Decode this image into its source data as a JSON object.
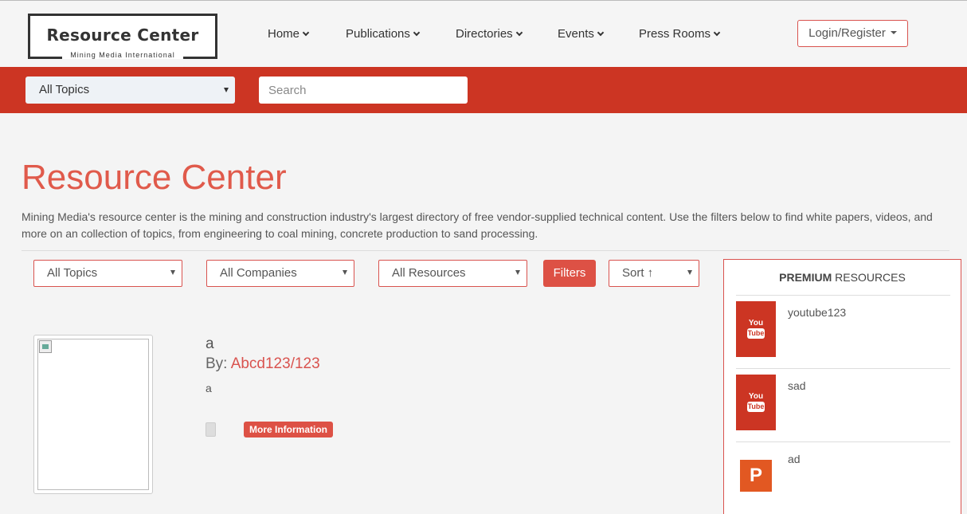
{
  "header": {
    "logo_title": "Resource Center",
    "logo_subtitle": "Mining Media International",
    "nav": [
      {
        "label": "Home"
      },
      {
        "label": "Publications"
      },
      {
        "label": "Directories"
      },
      {
        "label": "Events"
      },
      {
        "label": "Press Rooms"
      }
    ],
    "login_label": "Login/Register"
  },
  "searchbar": {
    "topic_selected": "All Topics",
    "search_placeholder": "Search"
  },
  "intro": {
    "title": "Resource Center",
    "description": "Mining Media's resource center is the mining and construction industry's largest directory of free vendor-supplied technical content. Use the filters below to find white papers, videos, and more on an collection of topics, from engineering to coal mining, concrete production to sand processing."
  },
  "filters": {
    "topics": "All Topics",
    "companies": "All Companies",
    "resources": "All Resources",
    "filters_button": "Filters",
    "sort": "Sort ↑"
  },
  "results": [
    {
      "title": "a",
      "by_label": "By:",
      "author": "Abcd123/123",
      "description": "a",
      "more_label": "More Information"
    }
  ],
  "premium": {
    "heading_bold": "PREMIUM",
    "heading_rest": "RESOURCES",
    "items": [
      {
        "name": "youtube123",
        "icon": "youtube-icon"
      },
      {
        "name": "sad",
        "icon": "youtube-icon"
      },
      {
        "name": "ad",
        "icon": "powerpoint-icon"
      }
    ]
  },
  "icon_text": {
    "you": "You",
    "tube": "Tube",
    "p": "P"
  },
  "colors": {
    "brand_red": "#cc3523",
    "accent_red": "#e05a4b",
    "button_red": "#dd5145"
  }
}
